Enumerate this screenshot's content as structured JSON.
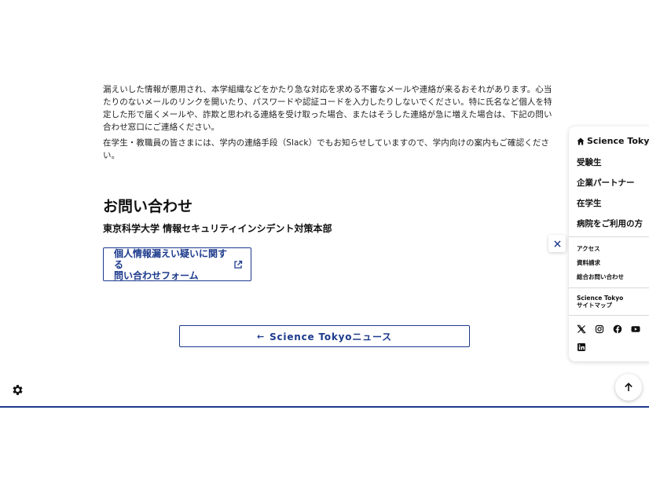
{
  "content": {
    "paragraph1": "漏えいした情報が悪用され、本学組織などをかたり急な対応を求める不審なメールや連絡が来るおそれがあります。心当たりのないメールのリンクを開いたり、パスワードや認証コードを入力したりしないでください。特に氏名など個人を特定した形で届くメールや、詐欺と思われる連絡を受け取った場合、またはそうした連絡が急に増えた場合は、下記の問い合わせ窓口にご連絡ください。",
    "paragraph2": "在学生・教職員の皆さまには、学内の連絡手段（Slack）でもお知らせしていますので、学内向けの案内もご確認ください。"
  },
  "contact": {
    "title": "お問い合わせ",
    "org": "東京科学大学 情報セキュリティインシデント対策本部",
    "form_label": "個人情報漏えい疑いに関する\n問い合わせフォーム"
  },
  "news_button": {
    "arrow": "←",
    "label": "Science Tokyoニュース"
  },
  "sidebar": {
    "brand": "Science Tokyo",
    "nav": [
      "受験生",
      "企業パートナー",
      "在学生",
      "病院をご利用の方"
    ],
    "links": [
      "アクセス",
      "資料請求",
      "総合お問い合わせ"
    ],
    "sitemap": "Science Tokyo\nサイトマップ",
    "social_icons": [
      "x-icon",
      "instagram-icon",
      "facebook-icon",
      "youtube-icon",
      "linkedin-icon"
    ]
  },
  "colors": {
    "accent": "#1c3a8c",
    "text": "#222222"
  }
}
